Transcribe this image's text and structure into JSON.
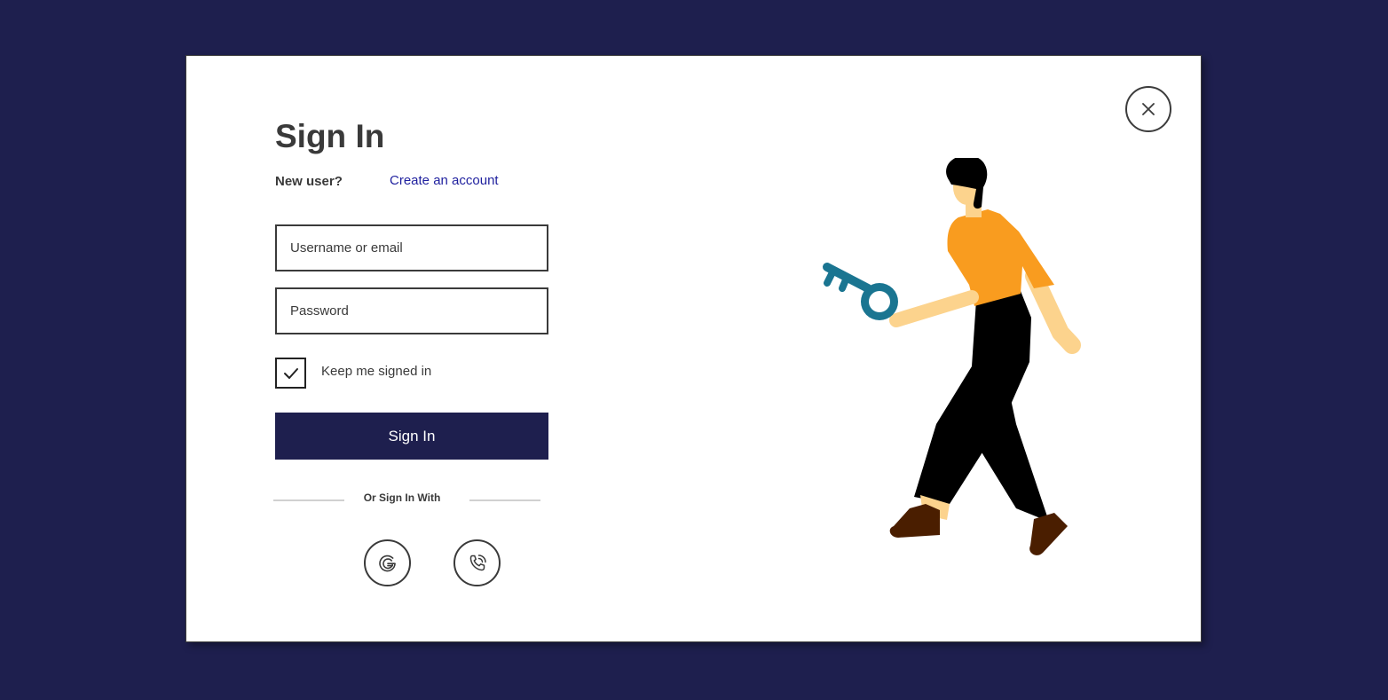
{
  "modal": {
    "title": "Sign In",
    "new_user_label": "New user?",
    "create_account_link": "Create an account",
    "close_icon": "close-icon"
  },
  "form": {
    "username_placeholder": "Username or email",
    "username_value": "",
    "password_placeholder": "Password",
    "password_value": "",
    "keep_signed_in_label": "Keep me signed in",
    "keep_signed_in_checked": true,
    "submit_label": "Sign In"
  },
  "social": {
    "divider_text": "Or Sign In With",
    "providers": [
      {
        "icon": "google-icon"
      },
      {
        "icon": "phone-icon"
      }
    ]
  },
  "colors": {
    "background": "#1e1f4e",
    "primary": "#1e1f4e",
    "link": "#1e1f9e",
    "shirt": "#f99c1f",
    "key": "#1a7591",
    "skin": "#fcd38d",
    "shoes": "#4a1e00"
  },
  "illustration": {
    "icon": "person-holding-key-illustration"
  }
}
